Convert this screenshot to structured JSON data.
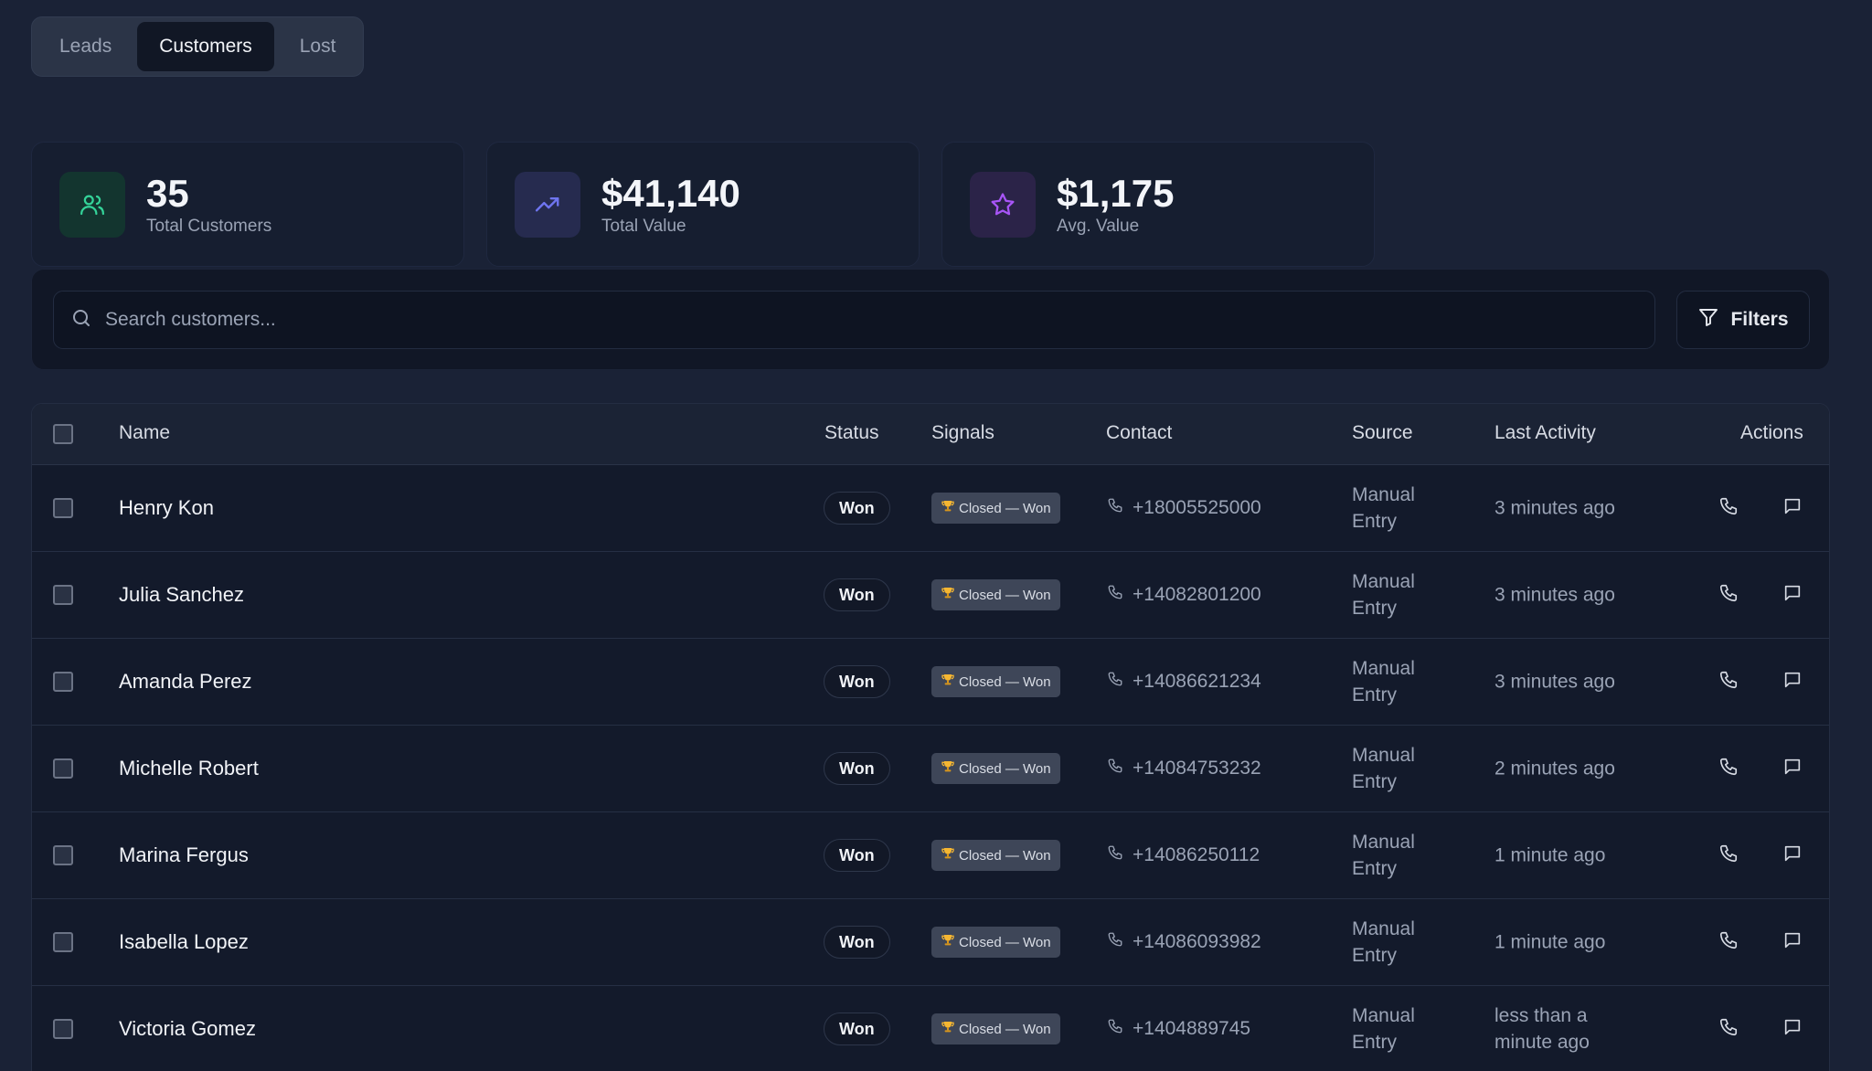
{
  "tabs": [
    {
      "label": "Leads",
      "active": false
    },
    {
      "label": "Customers",
      "active": true
    },
    {
      "label": "Lost",
      "active": false
    }
  ],
  "stats": [
    {
      "value": "35",
      "label": "Total Customers",
      "icon": "users-icon",
      "color": "#34d399"
    },
    {
      "value": "$41,140",
      "label": "Total Value",
      "icon": "trending-up-icon",
      "color": "#6366f1"
    },
    {
      "value": "$1,175",
      "label": "Avg. Value",
      "icon": "star-icon",
      "color": "#a855f7"
    }
  ],
  "search": {
    "placeholder": "Search customers...",
    "value": ""
  },
  "filters_label": "Filters",
  "table": {
    "headers": {
      "name": "Name",
      "status": "Status",
      "signals": "Signals",
      "contact": "Contact",
      "source": "Source",
      "last_activity": "Last Activity",
      "actions": "Actions"
    },
    "rows": [
      {
        "name": "Henry Kon",
        "status": "Won",
        "signal": "Closed — Won",
        "phone": "+18005525000",
        "source": "Manual Entry",
        "activity": "3 minutes ago"
      },
      {
        "name": "Julia Sanchez",
        "status": "Won",
        "signal": "Closed — Won",
        "phone": "+14082801200",
        "source": "Manual Entry",
        "activity": "3 minutes ago"
      },
      {
        "name": "Amanda Perez",
        "status": "Won",
        "signal": "Closed — Won",
        "phone": "+14086621234",
        "source": "Manual Entry",
        "activity": "3 minutes ago"
      },
      {
        "name": "Michelle Robert",
        "status": "Won",
        "signal": "Closed — Won",
        "phone": "+14084753232",
        "source": "Manual Entry",
        "activity": "2 minutes ago"
      },
      {
        "name": "Marina Fergus",
        "status": "Won",
        "signal": "Closed — Won",
        "phone": "+14086250112",
        "source": "Manual Entry",
        "activity": "1 minute ago"
      },
      {
        "name": "Isabella Lopez",
        "status": "Won",
        "signal": "Closed — Won",
        "phone": "+14086093982",
        "source": "Manual Entry",
        "activity": "1 minute ago"
      },
      {
        "name": "Victoria Gomez",
        "status": "Won",
        "signal": "Closed — Won",
        "phone": "+1404889745",
        "source": "Manual Entry",
        "activity": "less than a minute ago"
      }
    ]
  }
}
